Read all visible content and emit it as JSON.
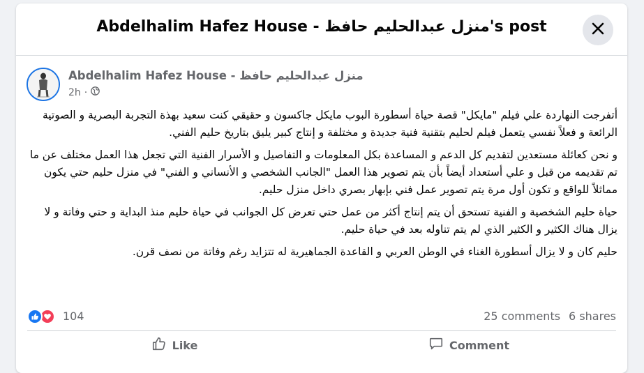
{
  "modal": {
    "title": "Abdelhalim Hafez House - منزل عبدالحليم حافظ's post"
  },
  "post": {
    "page_name": "Abdelhalim Hafez House - منزل عبدالحليم حافظ",
    "time": "2h",
    "separator": "·",
    "audience_icon": "globe-icon",
    "paragraphs": [
      "أتفرجت النهاردة علي فيلم \"مايكل\" قصة حياة أسطورة البوب مايكل جاكسون و حقيقي كنت سعيد بهذة التجربة البصرية و الصوتية الرائعة و فعلاً نفسي يتعمل فيلم لحليم بتقنية فنية جديدة و مختلفة و إنتاج كبير يليق بتاريخ حليم الفني.",
      "و نحن كعائلة مستعدين لتقديم كل الدعم و المساعدة بكل المعلومات و التفاصيل و الأسرار الفنية التي تجعل هذا العمل مختلف عن ما تم تقديمه من قبل و علي أستعداد أيضاً بأن يتم تصوير هذا العمل \"الجانب الشخصي و الأنساني و الفني\" في منزل حليم حتي يكون مماثلاً للواقع و تكون أول مرة يتم تصوير عمل فني بإبهار بصري داخل منزل حليم.",
      "حياة حليم الشخصية و الفنية تستحق أن يتم إنتاج أكثر من عمل حتي تعرض كل الجوانب في حياة حليم منذ البداية و حتي وفاتة و لا يزال هناك الكثير و الكثير الذي لم يتم تناوله بعد في حياة حليم.",
      "حليم كان و لا يزال أسطورة الغناء في الوطن العربي و القاعدة الجماهيرية له تتزايد رغم وفاتة من نصف قرن."
    ]
  },
  "reactions": {
    "icons": [
      "like-reaction-icon",
      "love-reaction-icon"
    ],
    "count": "104",
    "comments": "25 comments",
    "shares": "6 shares"
  },
  "actions": {
    "like": "Like",
    "comment": "Comment"
  },
  "colors": {
    "like_blue": "#1877f2",
    "love_red": "#f33e58",
    "secondary_text": "#65676b",
    "avatar_ring": "#1b74e4"
  }
}
